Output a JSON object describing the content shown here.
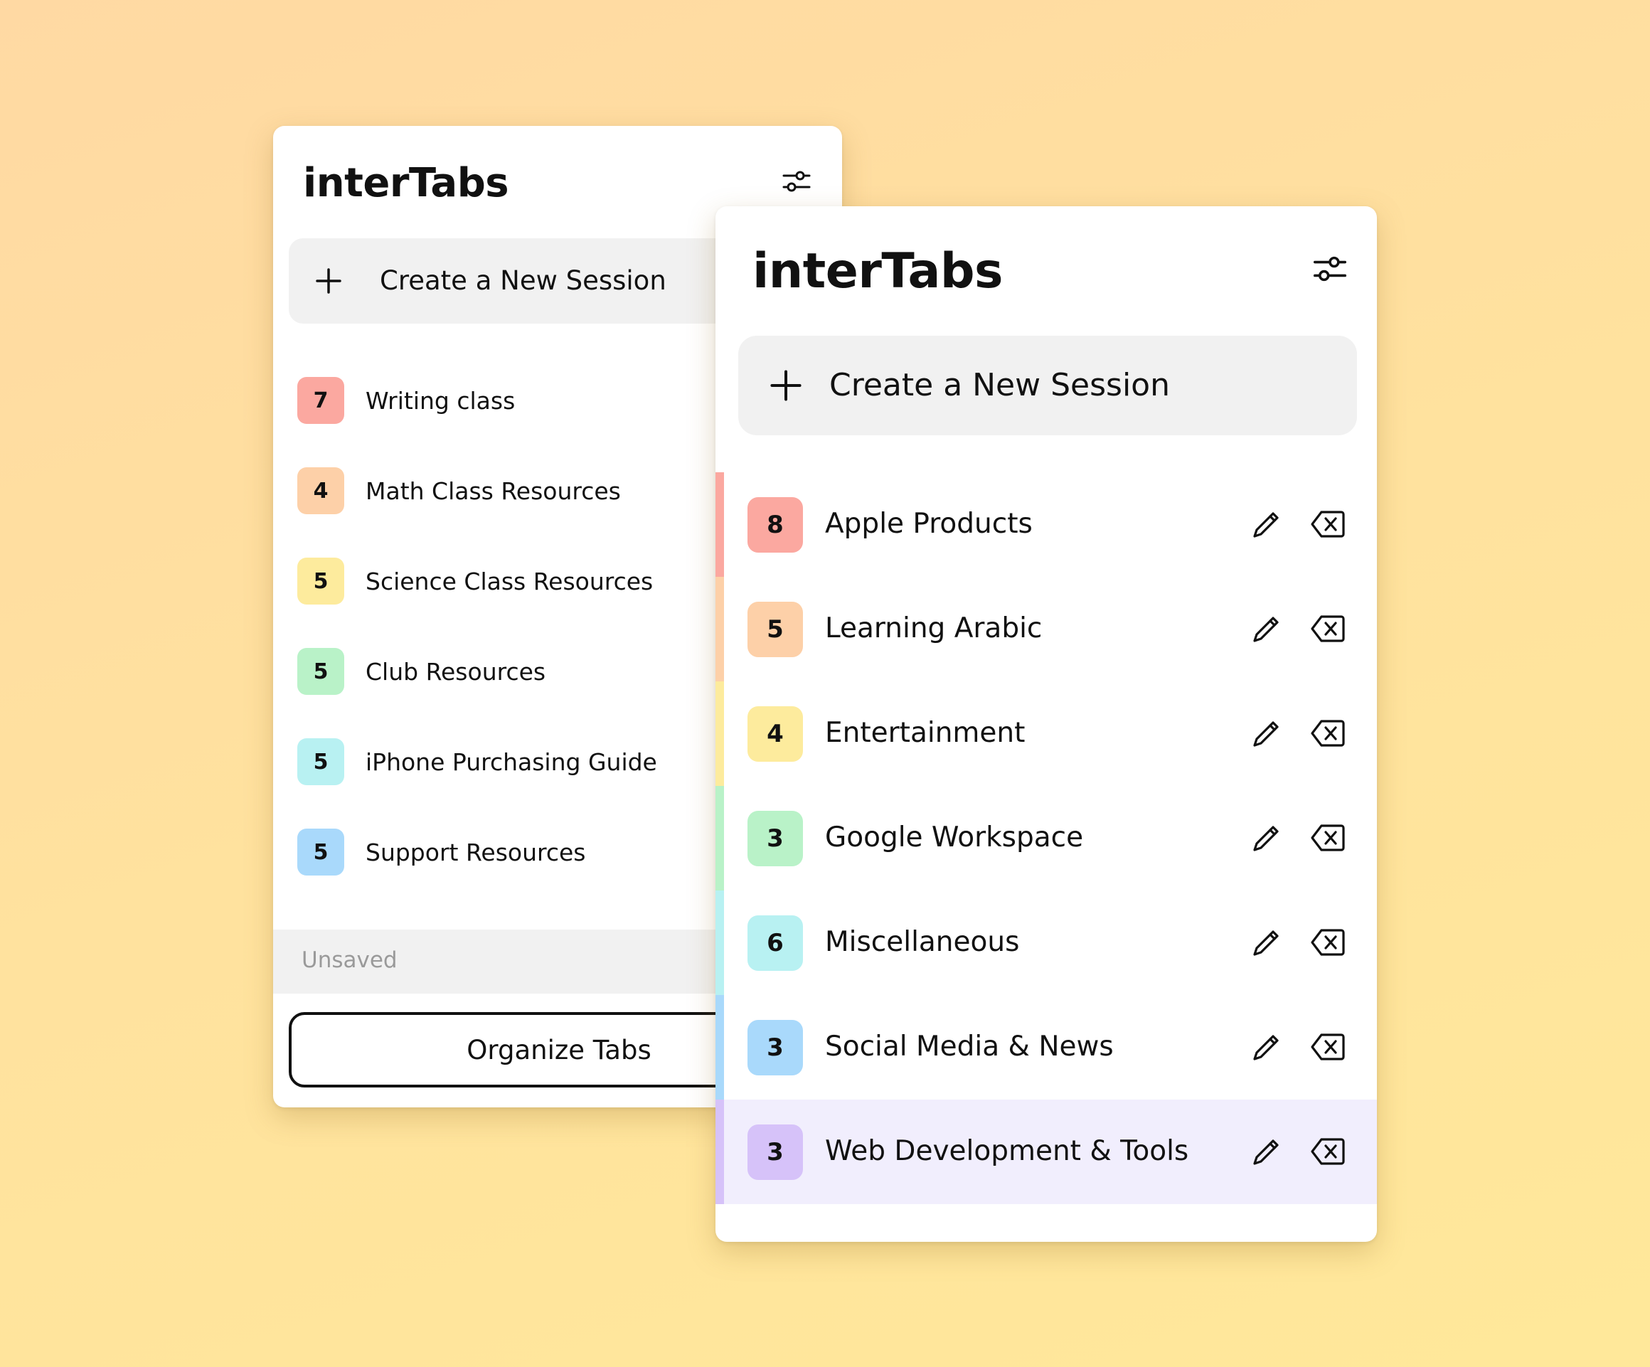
{
  "colors": {
    "red": "#fba8a0",
    "orange": "#fdd0a8",
    "yellow": "#fdeb9d",
    "green": "#b9f2c8",
    "cyan": "#b8f1f2",
    "blue": "#a9d9fb",
    "purple": "#d6c2f9",
    "selected_row": "#f1eefd"
  },
  "back_panel": {
    "app_title": "interTabs",
    "settings_icon": "sliders-icon",
    "create_button": {
      "icon": "plus-icon",
      "label": "Create a New Session"
    },
    "sessions": [
      {
        "count": "7",
        "name": "Writing class",
        "color": "#fba8a0"
      },
      {
        "count": "4",
        "name": "Math Class Resources",
        "color": "#fdd0a8"
      },
      {
        "count": "5",
        "name": "Science Class Resources",
        "color": "#fdeb9d"
      },
      {
        "count": "5",
        "name": "Club Resources",
        "color": "#b9f2c8"
      },
      {
        "count": "5",
        "name": "iPhone Purchasing Guide",
        "color": "#b8f1f2"
      },
      {
        "count": "5",
        "name": "Support Resources",
        "color": "#a9d9fb"
      }
    ],
    "unsaved_label": "Unsaved",
    "organize_button": "Organize Tabs"
  },
  "front_panel": {
    "app_title": "interTabs",
    "settings_icon": "sliders-icon",
    "create_button": {
      "icon": "plus-icon",
      "label": "Create a New Session"
    },
    "sessions": [
      {
        "count": "8",
        "name": "Apple Products",
        "color": "#fba8a0",
        "selected": false
      },
      {
        "count": "5",
        "name": "Learning Arabic",
        "color": "#fdd0a8",
        "selected": false
      },
      {
        "count": "4",
        "name": "Entertainment",
        "color": "#fdeb9d",
        "selected": false
      },
      {
        "count": "3",
        "name": "Google Workspace",
        "color": "#b9f2c8",
        "selected": false
      },
      {
        "count": "6",
        "name": "Miscellaneous",
        "color": "#b8f1f2",
        "selected": false
      },
      {
        "count": "3",
        "name": "Social Media & News",
        "color": "#a9d9fb",
        "selected": false
      },
      {
        "count": "3",
        "name": "Web Development & Tools",
        "color": "#d6c2f9",
        "selected": true
      }
    ],
    "row_actions": {
      "edit_icon": "pencil-icon",
      "delete_icon": "backspace-icon"
    }
  }
}
